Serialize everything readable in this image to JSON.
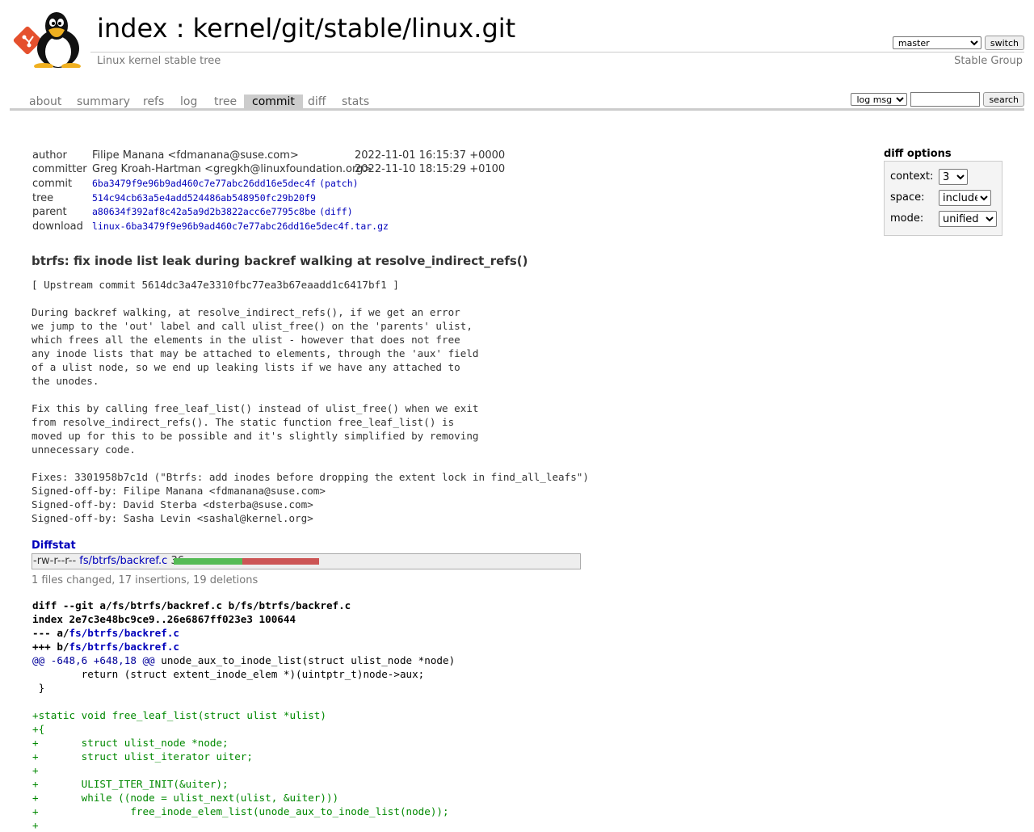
{
  "header": {
    "title_index": "index",
    "title_sep": ":",
    "title_repo": "kernel/git/stable/linux.git",
    "subtitle": "Linux kernel stable tree",
    "owner": "Stable Group",
    "branch_selected": "master",
    "switch_label": "switch"
  },
  "tabs": [
    {
      "label": "about"
    },
    {
      "label": "summary"
    },
    {
      "label": "refs"
    },
    {
      "label": "log"
    },
    {
      "label": "tree"
    },
    {
      "label": "commit"
    },
    {
      "label": "diff"
    },
    {
      "label": "stats"
    }
  ],
  "search": {
    "field_selected": "log msg",
    "value": "",
    "button_label": "search"
  },
  "commit_info": {
    "author_label": "author",
    "author": "Filipe Manana <fdmanana@suse.com>",
    "author_date": "2022-11-01 16:15:37 +0000",
    "committer_label": "committer",
    "committer": "Greg Kroah-Hartman <gregkh@linuxfoundation.org>",
    "committer_date": "2022-11-10 18:15:29 +0100",
    "commit_label": "commit",
    "commit": "6ba3479f9e96b9ad460c7e77abc26dd16e5dec4f",
    "commit_link": "(patch)",
    "tree_label": "tree",
    "tree": "514c94cb63a5e4add524486ab548950fc29b20f9",
    "parent_label": "parent",
    "parent": "a80634f392af8c42a5a9d2b3822acc6e7795c8be",
    "parent_link": "(diff)",
    "download_label": "download",
    "download": "linux-6ba3479f9e96b9ad460c7e77abc26dd16e5dec4f.tar.gz"
  },
  "diff_options": {
    "title": "diff options",
    "context_label": "context:",
    "context_value": "3",
    "space_label": "space:",
    "space_value": "include",
    "mode_label": "mode:",
    "mode_value": "unified"
  },
  "message": {
    "subject": "btrfs: fix inode list leak during backref walking at resolve_indirect_refs()",
    "body": "[ Upstream commit 5614dc3a47e3310fbc77ea3b67eaadd1c6417bf1 ]\n\nDuring backref walking, at resolve_indirect_refs(), if we get an error\nwe jump to the 'out' label and call ulist_free() on the 'parents' ulist,\nwhich frees all the elements in the ulist - however that does not free\nany inode lists that may be attached to elements, through the 'aux' field\nof a ulist node, so we end up leaking lists if we have any attached to\nthe unodes.\n\nFix this by calling free_leaf_list() instead of ulist_free() when we exit\nfrom resolve_indirect_refs(). The static function free_leaf_list() is\nmoved up for this to be possible and it's slightly simplified by removing\nunnecessary code.\n\nFixes: 3301958b7c1d (\"Btrfs: add inodes before dropping the extent lock in find_all_leafs\")\nSigned-off-by: Filipe Manana <fdmanana@suse.com>\nSigned-off-by: David Sterba <dsterba@suse.com>\nSigned-off-by: Sasha Levin <sashal@kernel.org>"
  },
  "diffstat": {
    "title": "Diffstat",
    "mode": "-rw-r--r--",
    "file": "fs/btrfs/backref.c",
    "changes": "36",
    "insertions": 17,
    "deletions": 19,
    "summary": "1 files changed, 17 insertions, 19 deletions",
    "colors": {
      "add": "#55bb55",
      "del": "#cc5555"
    }
  },
  "diff": {
    "head1": "diff --git a/fs/btrfs/backref.c b/fs/btrfs/backref.c",
    "head2": "index 2e7c3e48bc9ce9..26e6867ff023e3 100644",
    "head3_prefix": "--- a/",
    "head3_file": "fs/btrfs/backref.c",
    "head4_prefix": "+++ b/",
    "head4_file": "fs/btrfs/backref.c",
    "hunk": "@@ -648,6 +648,18 @@",
    "hunk_fn": " unode_aux_to_inode_list(struct ulist_node *node)",
    "lines": [
      {
        "type": "ctx",
        "text": " \treturn (struct extent_inode_elem *)(uintptr_t)node->aux;"
      },
      {
        "type": "ctx",
        "text": " }"
      },
      {
        "type": "ctx",
        "text": " "
      },
      {
        "type": "add",
        "text": "+static void free_leaf_list(struct ulist *ulist)"
      },
      {
        "type": "add",
        "text": "+{"
      },
      {
        "type": "add",
        "text": "+\tstruct ulist_node *node;"
      },
      {
        "type": "add",
        "text": "+\tstruct ulist_iterator uiter;"
      },
      {
        "type": "add",
        "text": "+"
      },
      {
        "type": "add",
        "text": "+\tULIST_ITER_INIT(&uiter);"
      },
      {
        "type": "add",
        "text": "+\twhile ((node = ulist_next(ulist, &uiter)))"
      },
      {
        "type": "add",
        "text": "+\t\tfree_inode_elem_list(unode_aux_to_inode_list(node));"
      },
      {
        "type": "add",
        "text": "+"
      }
    ]
  }
}
